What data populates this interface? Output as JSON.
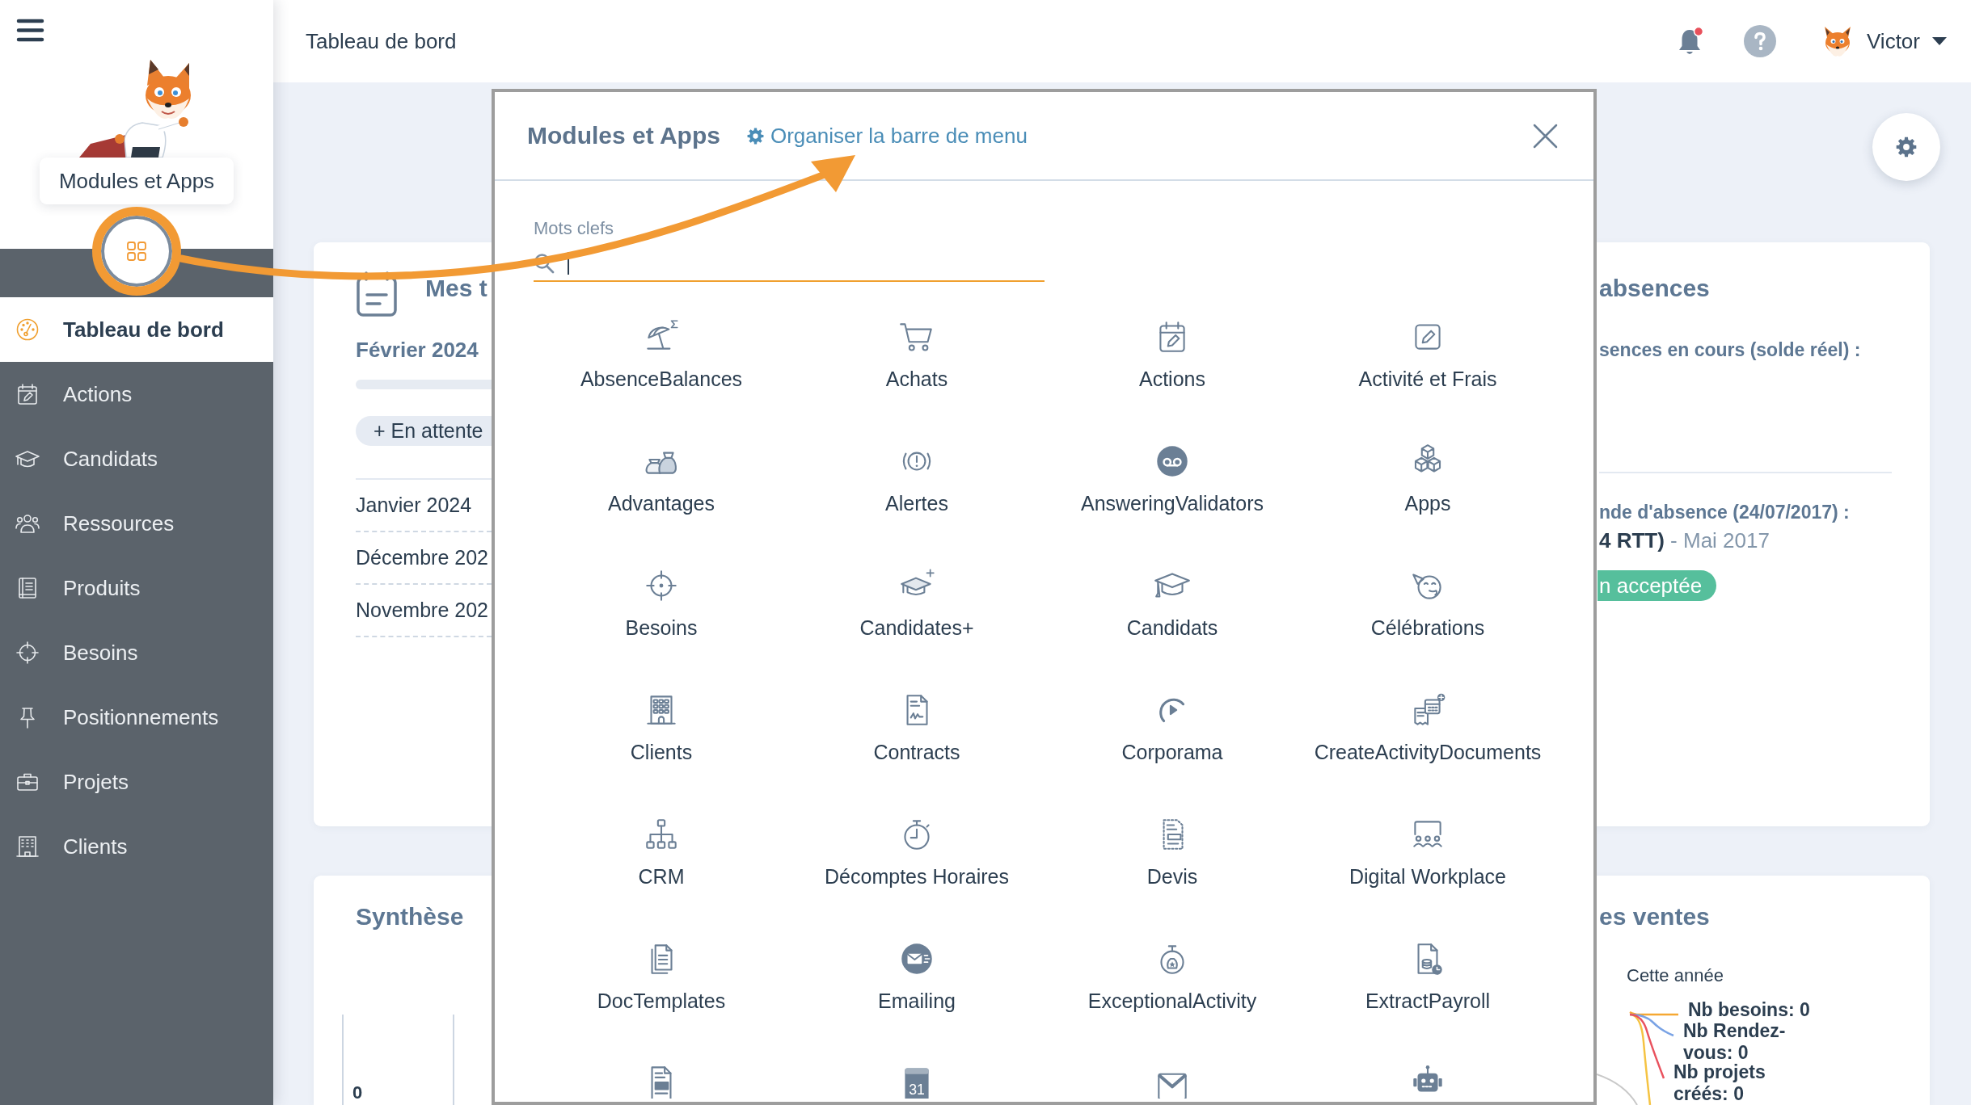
{
  "sidebar": {
    "menu_tooltip": "Modules et Apps",
    "items": [
      {
        "label": "Tableau de bord",
        "selected": true
      },
      {
        "label": "Actions",
        "selected": false
      },
      {
        "label": "Candidats",
        "selected": false
      },
      {
        "label": "Ressources",
        "selected": false
      },
      {
        "label": "Produits",
        "selected": false
      },
      {
        "label": "Besoins",
        "selected": false
      },
      {
        "label": "Positionnements",
        "selected": false
      },
      {
        "label": "Projets",
        "selected": false
      },
      {
        "label": "Clients",
        "selected": false
      }
    ]
  },
  "topbar": {
    "title": "Tableau de bord",
    "notifications": {
      "unread": true
    },
    "user": {
      "name": "Victor"
    }
  },
  "dashboard": {
    "tasks_card": {
      "title": "Mes t",
      "month": "Février 2024",
      "progress": {
        "level": 0
      },
      "pending_button": "+ En attente",
      "months": [
        "Janvier 2024",
        "Décembre 202",
        "Novembre 202"
      ]
    },
    "absences_card": {
      "title": "absences",
      "summary": "sences en cours (solde réel) :",
      "request": {
        "title": "nde d'absence (24/07/2017) :",
        "detail": "**4 RTT)** - Mai 2017",
        "status": "n acceptée"
      }
    },
    "summary_card": {
      "title": "Synthèse",
      "axis_label": "0"
    },
    "sales_card": {
      "title": "es ventes",
      "caption": "Cette année",
      "labels": [
        {
          "text": "Nb besoins: 0",
          "color": "#f5a833"
        },
        {
          "text": "Nb Rendez-vous: 0",
          "color": "#7aa3e5"
        },
        {
          "text": "Nb projets créés: 0",
          "color": "#e9525e"
        }
      ]
    }
  },
  "modal": {
    "title": "Modules et Apps",
    "organize_link": "Organiser la barre de menu",
    "search": {
      "label": "Mots clefs",
      "focused": true
    },
    "modules": [
      {
        "label": "AbsenceBalances"
      },
      {
        "label": "Achats"
      },
      {
        "label": "Actions"
      },
      {
        "label": "Activité et Frais"
      },
      {
        "label": "Advantages"
      },
      {
        "label": "Alertes"
      },
      {
        "label": "AnsweringValidators"
      },
      {
        "label": "Apps"
      },
      {
        "label": "Besoins"
      },
      {
        "label": "Candidates+"
      },
      {
        "label": "Candidats"
      },
      {
        "label": "Célébrations"
      },
      {
        "label": "Clients"
      },
      {
        "label": "Contracts"
      },
      {
        "label": "Corporama"
      },
      {
        "label": "CreateActivityDocuments"
      },
      {
        "label": "CRM"
      },
      {
        "label": "Décomptes Horaires"
      },
      {
        "label": "Devis"
      },
      {
        "label": "Digital Workplace"
      },
      {
        "label": "DocTemplates"
      },
      {
        "label": "Emailing"
      },
      {
        "label": "ExceptionalActivity"
      },
      {
        "label": "ExtractPayroll"
      }
    ],
    "cut_row": {
      "calendar_day": "31"
    }
  }
}
